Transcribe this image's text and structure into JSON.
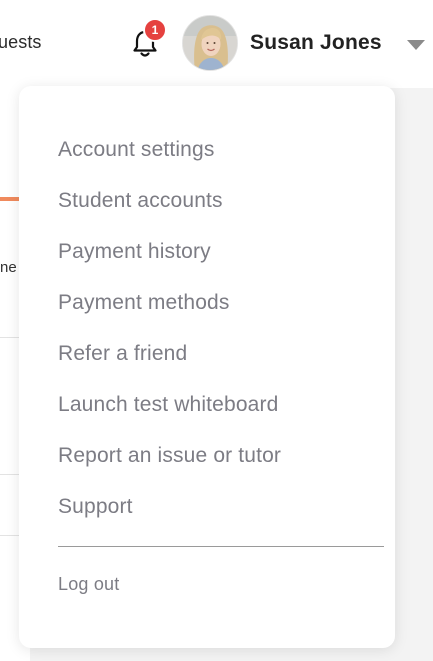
{
  "header": {
    "nav_link": "uests",
    "notifications_count": "1",
    "user_name": "Susan Jones",
    "icons": {
      "bell": "bell-icon",
      "caret": "caret-down-icon"
    }
  },
  "background": {
    "fragment_text": "ne",
    "accent_color": "#f08a5d"
  },
  "menu": {
    "items": [
      {
        "label": "Account settings"
      },
      {
        "label": "Student accounts"
      },
      {
        "label": "Payment history"
      },
      {
        "label": "Payment methods"
      },
      {
        "label": "Refer a friend"
      },
      {
        "label": "Launch test whiteboard"
      },
      {
        "label": "Report an issue or tutor"
      },
      {
        "label": "Support"
      }
    ],
    "logout_label": "Log out"
  },
  "colors": {
    "badge": "#e5413f",
    "menu_text": "#7c7c84",
    "name_text": "#222222"
  }
}
